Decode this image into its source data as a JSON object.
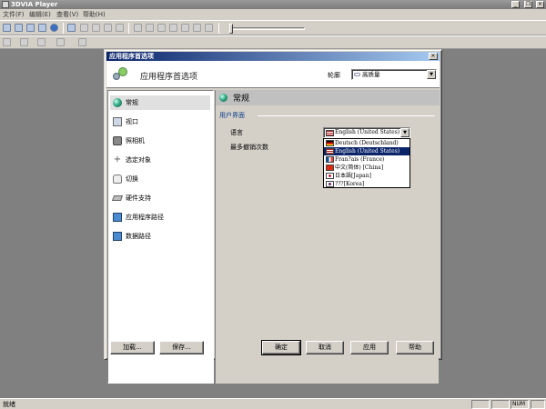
{
  "app": {
    "title": "3DVIA Player",
    "menu": [
      "文件(F)",
      "编辑(E)",
      "查看(V)",
      "帮助(H)"
    ]
  },
  "status": {
    "text": "就绪",
    "num": "NUM"
  },
  "dialog": {
    "title": "应用程序首选项",
    "header_title": "应用程序首选项",
    "quality_label": "轮廓",
    "quality_value": "高质量",
    "nav_items": [
      {
        "label": "常规",
        "icon": "globe-icon"
      },
      {
        "label": "视口",
        "icon": "viewport-icon"
      },
      {
        "label": "照相机",
        "icon": "camera-icon"
      },
      {
        "label": "选定对象",
        "icon": "crosshair-icon"
      },
      {
        "label": "切换",
        "icon": "hand-icon"
      },
      {
        "label": "硬件支持",
        "icon": "hardware-icon"
      },
      {
        "label": "应用程序路径",
        "icon": "app-path-icon"
      },
      {
        "label": "数据路径",
        "icon": "data-path-icon"
      }
    ],
    "section_title": "常规",
    "group_title": "用户界面",
    "language_label": "语言",
    "undo_label": "最多撤销次数",
    "language_value": "English (United States)",
    "language_options": [
      {
        "label": "Deutsch (Deutschland)",
        "flag": "de"
      },
      {
        "label": "English (United States)",
        "flag": "us"
      },
      {
        "label": "Fran?ais (France)",
        "flag": "fr"
      },
      {
        "label": "中文(简体) [China]",
        "flag": "cn"
      },
      {
        "label": "日本語[Japan]",
        "flag": "jp"
      },
      {
        "label": "???[Korea]",
        "flag": "kr"
      }
    ],
    "buttons": {
      "load": "加载...",
      "save": "保存...",
      "ok": "确定",
      "cancel": "取消",
      "apply": "应用",
      "help": "帮助"
    }
  },
  "colors": {
    "title_active": "#0a246a",
    "dialog_face": "#d4d0c8",
    "highlight": "#0a246a"
  }
}
